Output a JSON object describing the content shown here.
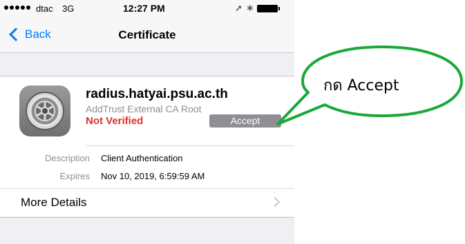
{
  "status_bar": {
    "carrier": "dtac",
    "network": "3G",
    "time": "12:27 PM",
    "icons": [
      "location-icon",
      "bluetooth-icon",
      "battery-icon"
    ]
  },
  "nav": {
    "back_label": "Back",
    "title": "Certificate"
  },
  "certificate": {
    "name": "radius.hatyai.psu.ac.th",
    "issuer": "AddTrust External CA Root",
    "status": "Not Verified",
    "accept_label": "Accept",
    "icon": "settings-gear-icon"
  },
  "details": {
    "rows": [
      {
        "label": "Description",
        "value": "Client Authentication"
      },
      {
        "label": "Expires",
        "value": "Nov 10, 2019, 6:59:59 AM"
      }
    ],
    "more_label": "More Details"
  },
  "callout": {
    "text": "กด  Accept"
  },
  "colors": {
    "ios_blue": "#007aff",
    "not_verified_red": "#e0302c",
    "accept_gray": "#8e8e93",
    "callout_border": "#1aa83a"
  }
}
